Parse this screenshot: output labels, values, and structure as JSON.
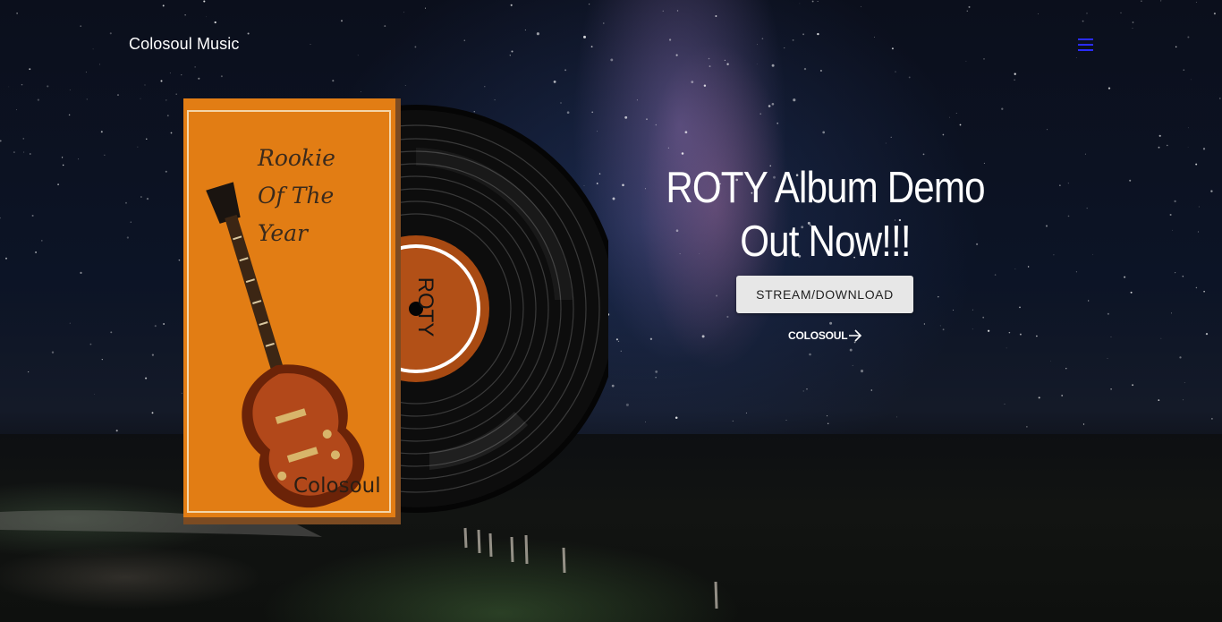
{
  "header": {
    "brand": "Colosoul Music",
    "menu_icon": "hamburger-menu-icon",
    "menu_color": "#2a2cff"
  },
  "album": {
    "title_lines": [
      "Rookie",
      "Of The",
      "Year"
    ],
    "artist": "Colosoul",
    "record_label": "ROTY",
    "cover_color": "#e07b12"
  },
  "hero": {
    "headline": "ROTY Album Demo Out Now!!!",
    "primary_button": "STREAM/DOWNLOAD",
    "secondary_link": "COLOSOUL",
    "secondary_icon": "arrow-right-icon"
  }
}
